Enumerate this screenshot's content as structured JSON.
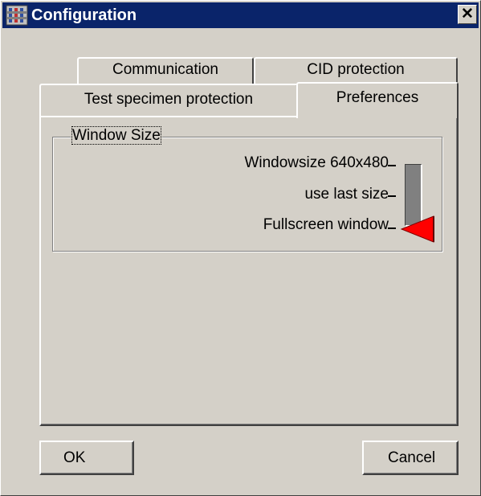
{
  "window": {
    "title": "Configuration",
    "close_label": "✕"
  },
  "tabs": {
    "back_row": [
      {
        "label": "Communication"
      },
      {
        "label": "CID protection"
      }
    ],
    "front_row": [
      {
        "label": "Test specimen protection"
      },
      {
        "label": "Preferences",
        "active": true
      }
    ]
  },
  "window_size": {
    "legend": "Window Size",
    "options": [
      {
        "label": "Windowsize 640x480"
      },
      {
        "label": "use last size"
      },
      {
        "label": "Fullscreen window"
      }
    ],
    "selected_index": 2,
    "thumb_color": "#ff0000"
  },
  "buttons": {
    "ok": "OK",
    "cancel": "Cancel"
  },
  "colors": {
    "face": "#d4d0c8",
    "title_bar": "#0a246a",
    "slider_thumb": "#ff0000"
  }
}
